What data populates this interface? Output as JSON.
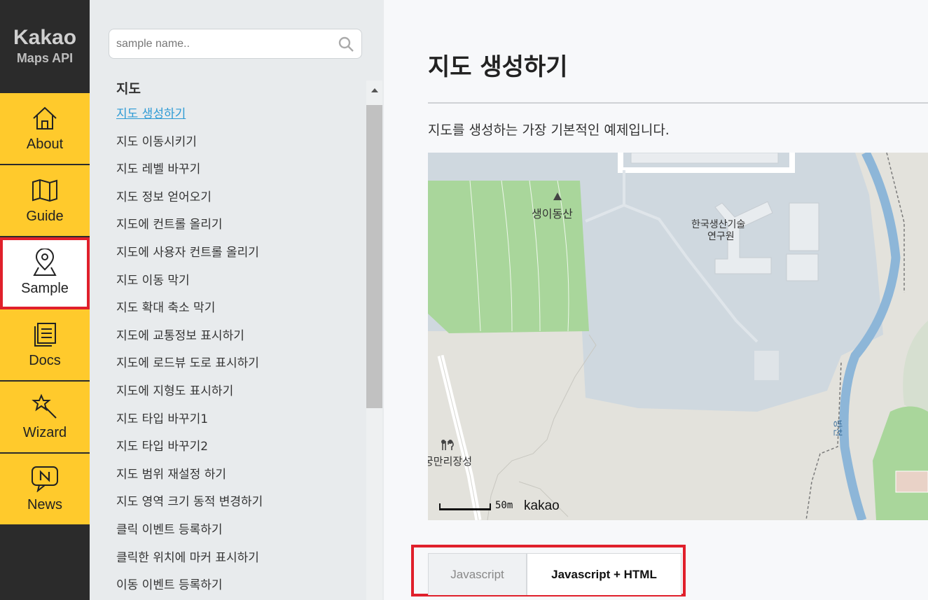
{
  "brand": {
    "line1": "Kakao",
    "line2": "Maps API"
  },
  "nav": [
    {
      "label": "About",
      "icon": "home-icon"
    },
    {
      "label": "Guide",
      "icon": "map-book-icon"
    },
    {
      "label": "Sample",
      "icon": "location-pin-icon",
      "active": true
    },
    {
      "label": "Docs",
      "icon": "documents-icon"
    },
    {
      "label": "Wizard",
      "icon": "magic-wand-icon"
    },
    {
      "label": "News",
      "icon": "news-bubble-icon"
    }
  ],
  "search": {
    "placeholder": "sample name..",
    "value": ""
  },
  "sample_list": {
    "section": "지도",
    "items": [
      "지도 생성하기",
      "지도 이동시키기",
      "지도 레벨 바꾸기",
      "지도 정보 얻어오기",
      "지도에 컨트롤 올리기",
      "지도에 사용자 컨트롤 올리기",
      "지도 이동 막기",
      "지도 확대 축소 막기",
      "지도에 교통정보 표시하기",
      "지도에 로드뷰 도로 표시하기",
      "지도에 지형도 표시하기",
      "지도 타입 바꾸기1",
      "지도 타입 바꾸기2",
      "지도 범위 재설정 하기",
      "지도 영역 크기 동적 변경하기",
      "클릭 이벤트 등록하기",
      "클릭한 위치에 마커 표시하기",
      "이동 이벤트 등록하기"
    ],
    "current": "지도 생성하기"
  },
  "main": {
    "title": "지도 생성하기",
    "description": "지도를 생성하는 가장 기본적인 예제입니다.",
    "map": {
      "labels": {
        "mountain": "생이동산",
        "institute_line1": "한국생산기술",
        "institute_line2": "연구원",
        "restaurant": "궁만리장성",
        "stream": "방천"
      },
      "scale_text": "50m",
      "logo": "kakao"
    },
    "tabs": [
      {
        "label": "Javascript",
        "active": false
      },
      {
        "label": "Javascript + HTML",
        "active": true
      }
    ]
  },
  "colors": {
    "nav_yellow": "#ffca2c",
    "rail_dark": "#2b2b2b",
    "highlight_red": "#e0202b",
    "link_blue": "#2e9bd5"
  }
}
